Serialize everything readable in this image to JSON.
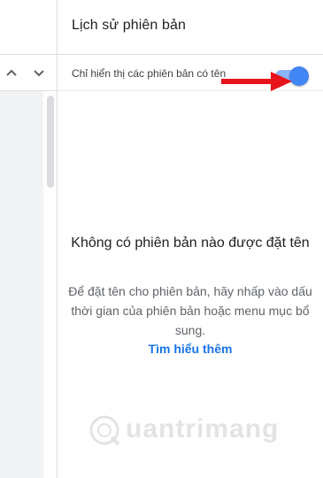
{
  "panel": {
    "title": "Lịch sử phiên bản",
    "toggle_label": "Chỉ hiển thị các phiên bản có tên",
    "toggle_on": true,
    "empty_state": {
      "title": "Không có phiên bản nào được đặt tên",
      "description": "Để đặt tên cho phiên bản, hãy nhấp vào dấu thời gian của phiên bản hoặc menu mục bổ sung.",
      "link": "Tìm hiểu thêm"
    }
  },
  "left_toolbar": {
    "icons": [
      "chevron-up-icon",
      "chevron-down-icon"
    ]
  },
  "watermark": {
    "text": "uantrimang"
  },
  "colors": {
    "accent": "#1a73e8",
    "toggle_knob": "#4285f4",
    "toggle_track": "#8ab4f8",
    "arrow": "#e8141b"
  }
}
